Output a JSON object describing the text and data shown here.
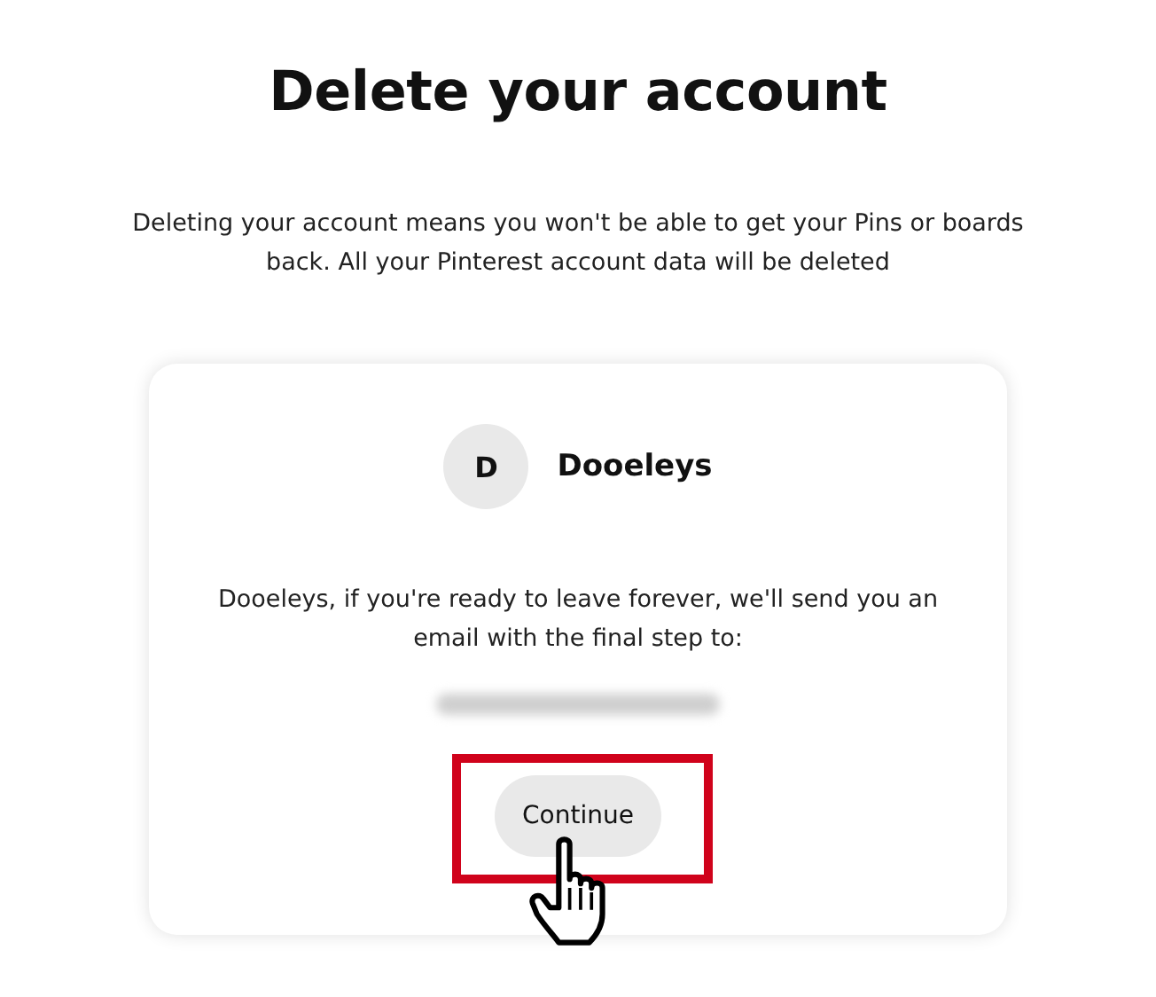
{
  "title": "Delete your account",
  "description": "Deleting your account means you won't be able to get your Pins or boards back. All your Pinterest account data will be deleted",
  "card": {
    "avatar_initial": "D",
    "username": "Dooeleys",
    "message": "Dooeleys, if you're ready to leave forever, we'll send you an email with the final step to:",
    "email_blurred": true,
    "button": "Continue",
    "highlighted": true
  }
}
